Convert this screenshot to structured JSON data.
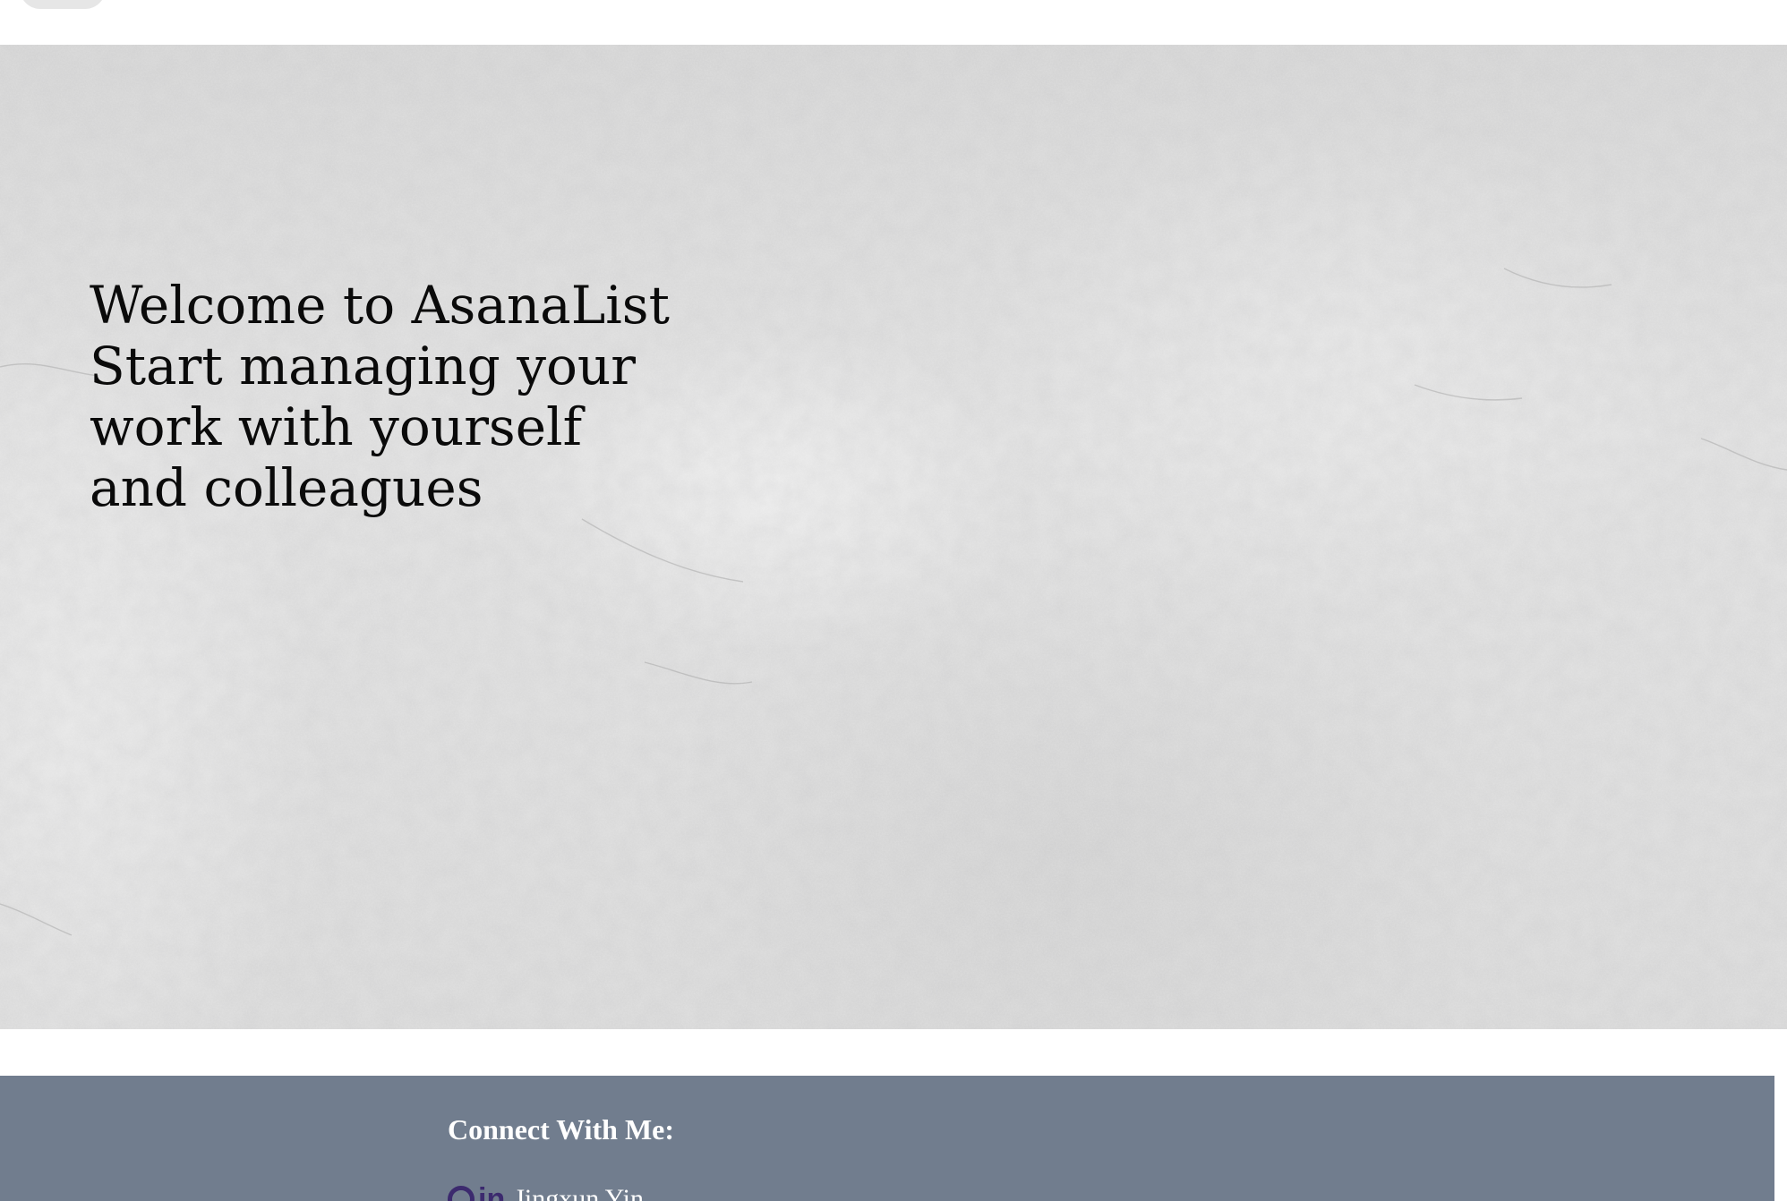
{
  "hero": {
    "lines": [
      "Welcome to AsanaList",
      "Start managing your",
      "work with yourself",
      "and colleagues"
    ]
  },
  "footer": {
    "heading": "Connect With Me:",
    "social": {
      "icons": [
        "github-icon",
        "linkedin-icon"
      ],
      "linkedin_glyph": "in",
      "name": "Jingxun Yin"
    }
  },
  "colors": {
    "footer_background": "#717d8e",
    "social_icon": "#3c2a6e",
    "hero_background": "#dcdcdc"
  }
}
